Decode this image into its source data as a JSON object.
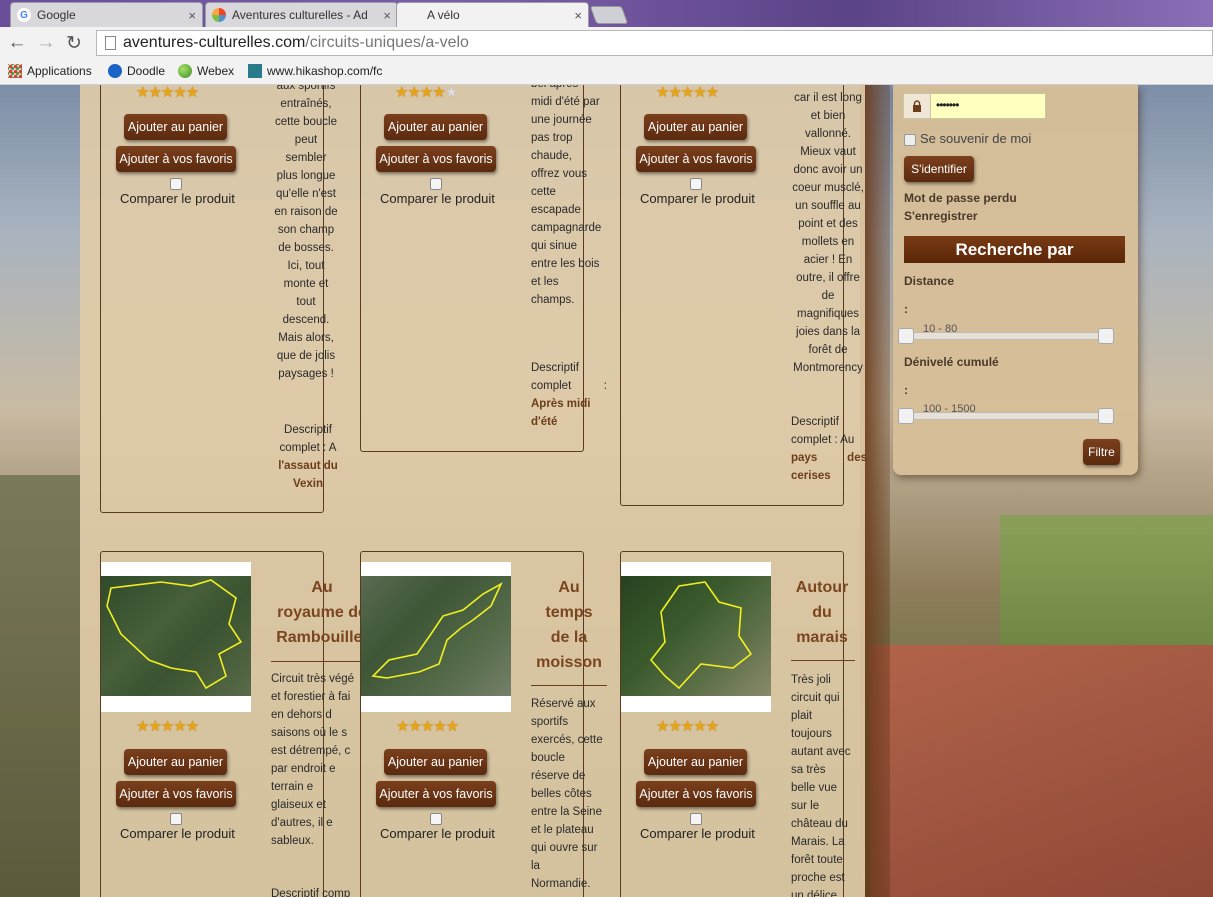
{
  "browser": {
    "tabs": [
      {
        "title": "Google",
        "icon": "google-icon"
      },
      {
        "title": "Aventures culturelles - Ad",
        "icon": "joomla-icon"
      },
      {
        "title": "A vélo",
        "icon": "none"
      }
    ],
    "url_host": "aventures-culturelles.com",
    "url_path": "/circuits-uniques/a-velo",
    "bookmarks": [
      {
        "label": "Applications",
        "icon": "apps-grid-icon"
      },
      {
        "label": "Doodle",
        "icon": "doodle-icon"
      },
      {
        "label": "Webex",
        "icon": "webex-icon"
      },
      {
        "label": "www.hikashop.com/fc",
        "icon": "hikashop-icon"
      }
    ],
    "close_symbol": "×"
  },
  "products_top": [
    {
      "rating": 5,
      "stars": "★★★★★",
      "add_cart": "Ajouter au panier",
      "add_fav": "Ajouter à vos favoris",
      "compare": "Comparer le produit",
      "desc_lines": [
        "aux sportifs",
        "entraînés,",
        "cette boucle",
        "peut",
        "sembler",
        "plus longue",
        "qu'elle n'est",
        "en raison de",
        "son champ",
        "de bosses.",
        "Ici, tout",
        "monte et",
        "tout",
        "descend.",
        "Mais alors,",
        "que de jolis",
        "paysages !"
      ],
      "more_prefix": "Descriptif",
      "more_line2": "complet : A",
      "more_link1": "l'assaut du",
      "more_link2": "Vexin"
    },
    {
      "rating": 4,
      "stars": "★★★★",
      "star_empty": "★",
      "add_cart": "Ajouter au panier",
      "add_fav": "Ajouter à vos favoris",
      "compare": "Comparer le produit",
      "desc_lines": [
        "bel après-",
        "midi d'été par",
        "une journée",
        "pas trop",
        "chaude,",
        "offrez vous",
        "cette",
        "escapade",
        "campagnarde",
        "qui sinue",
        "entre les bois",
        "et les",
        "champs."
      ],
      "more_prefix": "Descriptif",
      "more_line2": "complet :",
      "more_link1": "Après midi",
      "more_link2": "d'été"
    },
    {
      "rating": 5,
      "stars": "★★★★★",
      "add_cart": "Ajouter au panier",
      "add_fav": "Ajouter à vos favoris",
      "compare": "Comparer le produit",
      "desc_lines": [
        "car il est long",
        "et bien",
        "vallonné.",
        "Mieux vaut",
        "donc avoir un",
        "coeur musclé,",
        "un souffle au",
        "point et des",
        "mollets en",
        "acier ! En",
        "outre, il offre",
        "de",
        "magnifiques",
        "joies dans la",
        "forêt de",
        "Montmorency"
      ],
      "more_prefix": "Descriptif",
      "more_line2": "complet : Au",
      "more_link1": "pays des",
      "more_link2": "cerises"
    }
  ],
  "products_bottom": [
    {
      "title_lines": [
        "Au",
        "royaume de",
        "Rambouillet"
      ],
      "stars": "★★★★★",
      "add_cart": "Ajouter au panier",
      "add_fav": "Ajouter à vos favoris",
      "compare": "Comparer le produit",
      "desc_lines": [
        "Circuit très végé",
        "et forestier à fai",
        "en dehors d",
        "saisons où le s",
        "est détrempé, c",
        "par endroit e",
        "terrain e",
        "glaiseux et",
        "d'autres, il e",
        "sableux."
      ],
      "more_prefix": "Descriptif comp"
    },
    {
      "title_lines": [
        "Au",
        "temps",
        "de la",
        "moisson"
      ],
      "stars": "★★★★★",
      "add_cart": "Ajouter au panier",
      "add_fav": "Ajouter à vos favoris",
      "compare": "Comparer le produit",
      "desc_lines": [
        "Réservé aux",
        "sportifs",
        "exercés, cette",
        "boucle",
        "réserve de",
        "belles côtes",
        "entre la Seine",
        "et le plateau",
        "qui ouvre sur",
        "la",
        "Normandie."
      ]
    },
    {
      "title_lines": [
        "Autour",
        "du",
        "marais"
      ],
      "stars": "★★★★★",
      "add_cart": "Ajouter au panier",
      "add_fav": "Ajouter à vos favoris",
      "compare": "Comparer le produit",
      "desc_lines": [
        "Très joli",
        "circuit qui",
        "plait",
        "toujours",
        "autant avec",
        "sa très",
        "belle vue",
        "sur le",
        "château du",
        "Marais. La",
        "forêt toute",
        "proche est",
        "un délice"
      ]
    }
  ],
  "sidebar": {
    "password_value": "•••••••",
    "remember_label": "Se souvenir de moi",
    "login_button": "S'identifier",
    "lost_password": "Mot de passe perdu",
    "register": "S'enregistrer",
    "search_header": "Recherche par",
    "distance_label": "Distance",
    "colon": ":",
    "distance_range": "10 - 80",
    "elevation_label": "Dénivelé cumulé",
    "elevation_range": "100 - 1500",
    "filter_button": "Filtre"
  }
}
